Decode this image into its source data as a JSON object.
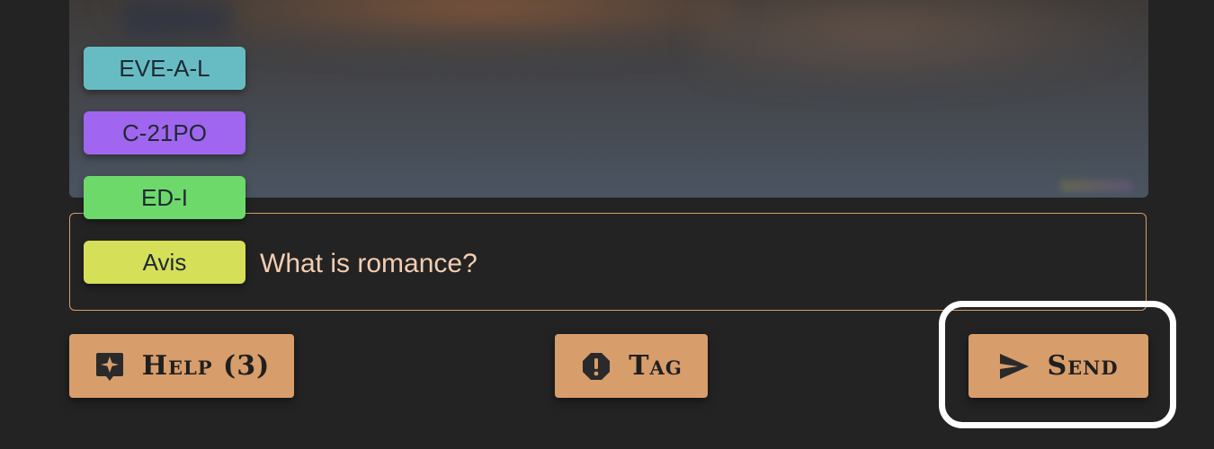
{
  "tags": [
    {
      "label": "EVE-A-L",
      "color": "#67bcc4"
    },
    {
      "label": "C-21PO",
      "color": "#a066ef"
    },
    {
      "label": "ED-I",
      "color": "#6cd96a"
    },
    {
      "label": "Avis",
      "color": "#d5e058"
    }
  ],
  "message": {
    "text": "What is romance?",
    "border_color": "#d79e6c",
    "text_color": "#f3cdb0"
  },
  "buttons": {
    "help_label": "Help (3)",
    "tag_label": "Tag",
    "send_label": "Send",
    "color": "#d79d6b"
  },
  "icons": {
    "help": "sparkle-chat-icon",
    "tag": "exclamation-octagon-icon",
    "send": "paper-plane-icon"
  }
}
